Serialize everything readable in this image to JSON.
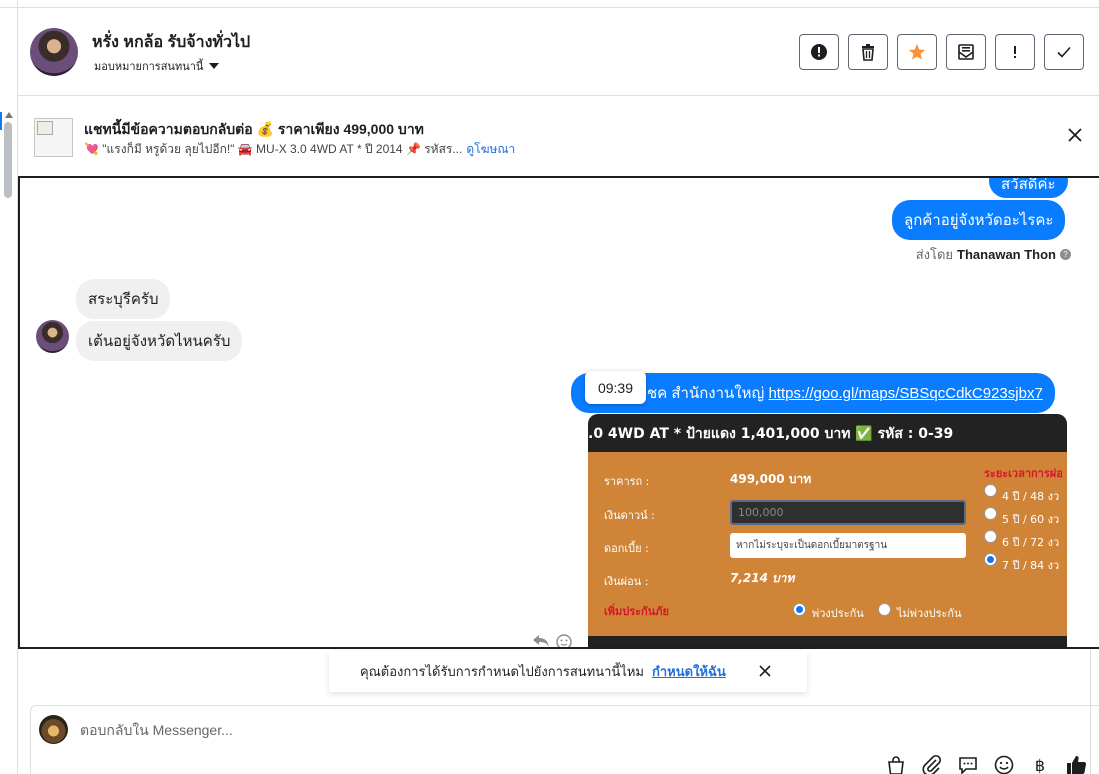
{
  "header": {
    "contact_name": "หรั่ง หกล้อ รับจ้างทั่วไป",
    "assign_label": "มอบหมายการสนทนานี้",
    "actions": [
      {
        "name": "report-icon",
        "glyph": "!"
      },
      {
        "name": "trash-icon"
      },
      {
        "name": "star-icon",
        "color": "#f7923b"
      },
      {
        "name": "mark-unread-icon"
      },
      {
        "name": "flag-icon",
        "glyph": "!"
      },
      {
        "name": "check-icon"
      }
    ]
  },
  "ad": {
    "title": "แชทนี้มีข้อความตอบกลับต่อ 💰 ราคาเพียง 499,000 บาท",
    "subtitle": "💘 \"แรงก็มี หรูด้วย ลุยไปอีก!\" 🚘 MU-X 3.0 4WD AT * ปี 2014 📌 รหัสร...",
    "link": "ดูโฆษณา"
  },
  "messages": {
    "out_partial": "สวัสดีค่ะ",
    "out_1": "ลูกค้าอยู่จังหวัดอะไรคะ",
    "sent_by_prefix": "ส่งโดย",
    "sent_by_name": "Thanawan Thon",
    "in_1": "สระบุรีครับ",
    "in_2": "เต้นอยู่จังหวัดไหนครับ",
    "time_tooltip": "09:39",
    "out_2_text": "ชค สำนักงานใหญ่",
    "out_2_link": "https://goo.gl/maps/SBSqcCdkC923sjbx7"
  },
  "car_card": {
    "headline": ".0 4WD AT * ป้ายแดง 1,401,000 บาท ✅ รหัส : 0-39",
    "price_label": "ราคารถ :",
    "price_value": "499,000 บาท",
    "down_label": "เงินดาวน์ :",
    "down_value": "100,000",
    "interest_label": "ดอกเบี้ย :",
    "interest_placeholder": "หากไม่ระบุจะเป็นดอกเบี้ยมาตรฐาน",
    "installment_label": "เงินผ่อน :",
    "installment_value": "7,214 บาท",
    "insurance_label": "เพิ่มประกันภัย",
    "insurance_yes": "พ่วงประกัน",
    "insurance_no": "ไม่พ่วงประกัน",
    "term_title": "ระยะเวลาการผ่อ",
    "terms": [
      "4 ปี / 48 งว",
      "5 ปี / 60 งว",
      "6 ปี / 72 งว",
      "7 ปี / 84 งว"
    ],
    "selected_term": "7 ปี / 84 งว",
    "colors": {
      "card": "#cf8437",
      "header": "#222222",
      "accent_red": "#d6192a"
    }
  },
  "prompt": {
    "text": "คุณต้องการได้รับการกำหนดไปยังการสนทนานี้ไหม",
    "link": "กำหนดให้ฉัน"
  },
  "composer": {
    "placeholder": "ตอบกลับใน Messenger...",
    "tools": [
      "bag-icon",
      "paperclip-icon",
      "saved-reply-icon",
      "emoji-icon",
      "baht-icon",
      "like-icon"
    ]
  },
  "colors": {
    "brand_blue": "#0a7cff",
    "link_blue": "#216fdb"
  }
}
